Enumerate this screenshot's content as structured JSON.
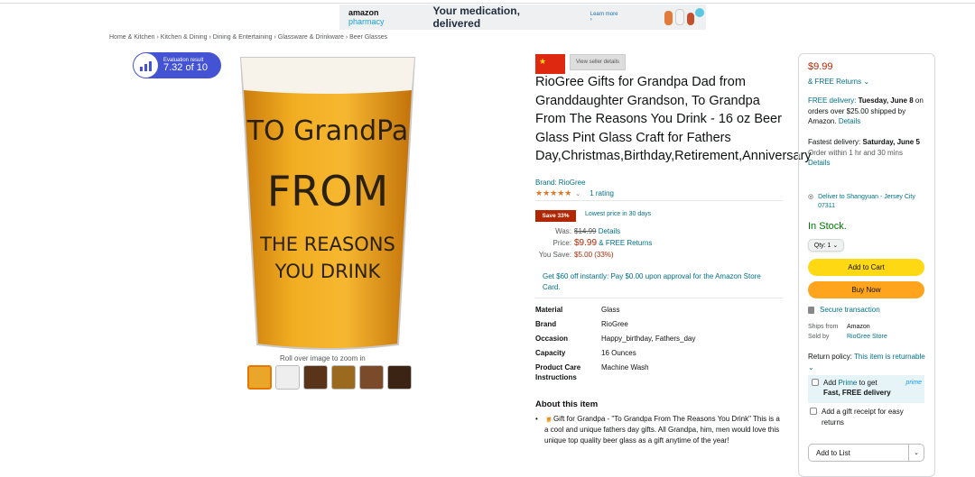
{
  "banner": {
    "brand_a": "amazon",
    "brand_b": "pharmacy",
    "tagline": "Your medication, delivered",
    "learn_more": "Learn more ›"
  },
  "breadcrumb": "Home & Kitchen › Kitchen & Dining › Dining & Entertaining › Glassware & Drinkware › Beer Glasses",
  "evaluation": {
    "label": "Evaluation result",
    "score": "7.32 of 10"
  },
  "image": {
    "lines": [
      "TO GrandPa",
      "FROM",
      "THE REASONS",
      "YOU DRINK"
    ],
    "rollover": "Roll over image to zoom in"
  },
  "seller": {
    "button": "View seller details"
  },
  "product": {
    "title": "RioGree Gifts for Grandpa Dad from Granddaughter Grandson, To Grandpa From The Reasons You Drink - 16 oz Beer Glass Pint Glass Craft for Fathers Day,Christmas,Birthday,Retirement,Anniversary",
    "brand": "Brand: RioGree",
    "stars": "★★★★★",
    "ratings": "1 rating"
  },
  "pricing": {
    "save_badge": "Save 33%",
    "lowest": "Lowest price in 30 days",
    "was_label": "Was:",
    "was_value": "$14.99",
    "details": "Details",
    "price_label": "Price:",
    "price_value": "$9.99",
    "free_returns": "& FREE Returns",
    "yousave_label": "You Save:",
    "yousave_value": "$5.00 (33%)",
    "offer": "Get $60 off instantly: Pay $0.00 upon approval for the Amazon Store Card."
  },
  "specs": [
    {
      "k": "Material",
      "v": "Glass"
    },
    {
      "k": "Brand",
      "v": "RioGree"
    },
    {
      "k": "Occasion",
      "v": "Happy_birthday, Fathers_day"
    },
    {
      "k": "Capacity",
      "v": "16 Ounces"
    },
    {
      "k": "Product Care Instructions",
      "v": "Machine Wash"
    }
  ],
  "about": {
    "heading": "About this item",
    "bullet1": "🍺Gift for Grandpa - \"To Grandpa From The Reasons You Drink\" This is a a cool and unique fathers day gifts. All Grandpa, him, men would love this unique top quality beer glass as a gift anytime of the year!"
  },
  "buybox": {
    "price": "$9.99",
    "free_returns": "& FREE Returns ⌄",
    "free_delivery": "FREE delivery:",
    "delivery_date": "Tuesday, June 8",
    "delivery_rest": "on orders over $25.00 shipped by Amazon.",
    "details": "Details",
    "fastest_label": "Fastest delivery:",
    "fastest_date": "Saturday, June 5",
    "order_within": "Order within 1 hr and 30 mins",
    "location": "Deliver to Shangyuan - Jersey City 07311",
    "stock": "In Stock.",
    "qty": "Qty: 1 ⌄",
    "add_to_cart": "Add to Cart",
    "buy_now": "Buy Now",
    "secure": "Secure transaction",
    "ships_from_label": "Ships from",
    "ships_from": "Amazon",
    "sold_by_label": "Sold by",
    "sold_by": "RioGree Store",
    "return_label": "Return policy:",
    "return_value": "This item is returnable ⌄",
    "prime_add": "Add",
    "prime_word": "Prime",
    "prime_rest": "to get",
    "prime_bold": "Fast, FREE delivery",
    "prime_logo": "prime",
    "gift": "Add a gift receipt for easy returns",
    "add_to_list": "Add to List",
    "dropdown": "⌄"
  }
}
